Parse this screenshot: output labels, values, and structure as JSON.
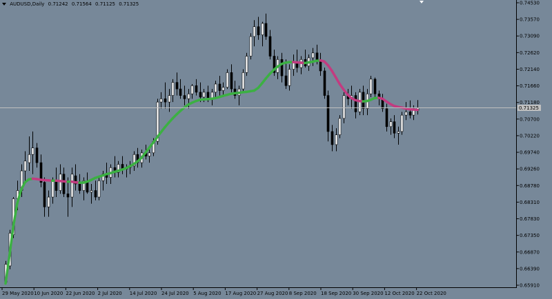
{
  "header": {
    "symbol": "AUDUSD,Daily",
    "open": "0.71242",
    "high": "0.71564",
    "low": "0.71125",
    "close": "0.71325"
  },
  "colors": {
    "background": "#778899",
    "bull_body": "#ffffff",
    "bear_body": "#000000",
    "wick": "#000000",
    "ma_up": "#3cb043",
    "ma_down": "#c23b80",
    "bid_line": "#c0c0c0",
    "current_label_bg": "#c0c0c0"
  },
  "price_axis": {
    "labels": [
      "0.74530",
      "0.73570",
      "0.73090",
      "0.72620",
      "0.72140",
      "0.71660",
      "0.71180",
      "0.70700",
      "0.70220",
      "0.69740",
      "0.69260",
      "0.68780",
      "0.68310",
      "0.67830",
      "0.67350",
      "0.66870",
      "0.66390",
      "0.65910"
    ],
    "current_price_label": "0.71325"
  },
  "time_axis": {
    "labels": [
      "29 May 2020",
      "10 Jun 2020",
      "22 Jun 2020",
      "2 Jul 2020",
      "14 Jul 2020",
      "24 Jul 2020",
      "5 Aug 2020",
      "17 Aug 2020",
      "27 Aug 2020",
      "8 Sep 2020",
      "18 Sep 2020",
      "30 Sep 2020",
      "12 Oct 2020",
      "22 Oct 2020"
    ]
  },
  "chart_data": {
    "type": "candlestick",
    "symbol": "AUDUSD",
    "timeframe": "Daily",
    "ylim": [
      0.6591,
      0.7453
    ],
    "current_price": 0.71325,
    "candles": [
      [
        0.66,
        0.6665,
        0.6595,
        0.6655
      ],
      [
        0.665,
        0.676,
        0.664,
        0.675
      ],
      [
        0.6745,
        0.686,
        0.6735,
        0.6855
      ],
      [
        0.6855,
        0.691,
        0.682,
        0.688
      ],
      [
        0.688,
        0.696,
        0.686,
        0.694
      ],
      [
        0.694,
        0.7,
        0.69,
        0.697
      ],
      [
        0.6965,
        0.7045,
        0.694,
        0.699
      ],
      [
        0.699,
        0.706,
        0.693,
        0.701
      ],
      [
        0.701,
        0.7025,
        0.695,
        0.6965
      ],
      [
        0.6965,
        0.699,
        0.689,
        0.6905
      ],
      [
        0.6905,
        0.692,
        0.68,
        0.683
      ],
      [
        0.683,
        0.688,
        0.68,
        0.686
      ],
      [
        0.686,
        0.692,
        0.684,
        0.691
      ],
      [
        0.691,
        0.695,
        0.686,
        0.688
      ],
      [
        0.688,
        0.696,
        0.687,
        0.693
      ],
      [
        0.693,
        0.695,
        0.686,
        0.687
      ],
      [
        0.687,
        0.692,
        0.68,
        0.686
      ],
      [
        0.686,
        0.695,
        0.683,
        0.693
      ],
      [
        0.6925,
        0.696,
        0.688,
        0.69
      ],
      [
        0.69,
        0.693,
        0.687,
        0.688
      ],
      [
        0.688,
        0.692,
        0.685,
        0.691
      ],
      [
        0.6905,
        0.6935,
        0.687,
        0.6875
      ],
      [
        0.6875,
        0.69,
        0.684,
        0.688
      ],
      [
        0.688,
        0.691,
        0.685,
        0.686
      ],
      [
        0.686,
        0.6925,
        0.685,
        0.691
      ],
      [
        0.691,
        0.694,
        0.688,
        0.693
      ],
      [
        0.693,
        0.6965,
        0.69,
        0.692
      ],
      [
        0.692,
        0.696,
        0.69,
        0.695
      ],
      [
        0.695,
        0.6985,
        0.692,
        0.6935
      ],
      [
        0.6935,
        0.697,
        0.692,
        0.696
      ],
      [
        0.696,
        0.6985,
        0.693,
        0.6945
      ],
      [
        0.6945,
        0.696,
        0.692,
        0.695
      ],
      [
        0.695,
        0.697,
        0.693,
        0.6955
      ],
      [
        0.6955,
        0.7,
        0.694,
        0.699
      ],
      [
        0.699,
        0.701,
        0.695,
        0.6965
      ],
      [
        0.6965,
        0.7005,
        0.695,
        0.6995
      ],
      [
        0.6995,
        0.702,
        0.6975,
        0.6985
      ],
      [
        0.6985,
        0.7005,
        0.6965,
        0.6995
      ],
      [
        0.6995,
        0.704,
        0.6985,
        0.703
      ],
      [
        0.703,
        0.716,
        0.702,
        0.715
      ],
      [
        0.715,
        0.718,
        0.713,
        0.716
      ],
      [
        0.716,
        0.721,
        0.713,
        0.715
      ],
      [
        0.715,
        0.719,
        0.712,
        0.717
      ],
      [
        0.717,
        0.722,
        0.715,
        0.721
      ],
      [
        0.721,
        0.724,
        0.717,
        0.719
      ],
      [
        0.719,
        0.722,
        0.716,
        0.717
      ],
      [
        0.717,
        0.72,
        0.714,
        0.716
      ],
      [
        0.716,
        0.719,
        0.713,
        0.7175
      ],
      [
        0.7175,
        0.7205,
        0.716,
        0.72
      ],
      [
        0.72,
        0.722,
        0.717,
        0.718
      ],
      [
        0.718,
        0.721,
        0.715,
        0.7165
      ],
      [
        0.7165,
        0.719,
        0.715,
        0.718
      ],
      [
        0.718,
        0.72,
        0.715,
        0.716
      ],
      [
        0.716,
        0.719,
        0.714,
        0.718
      ],
      [
        0.718,
        0.7215,
        0.716,
        0.7205
      ],
      [
        0.7205,
        0.723,
        0.717,
        0.7185
      ],
      [
        0.7185,
        0.721,
        0.7165,
        0.7195
      ],
      [
        0.7195,
        0.725,
        0.719,
        0.724
      ],
      [
        0.724,
        0.7265,
        0.718,
        0.719
      ],
      [
        0.719,
        0.7215,
        0.716,
        0.717
      ],
      [
        0.717,
        0.72,
        0.714,
        0.719
      ],
      [
        0.719,
        0.725,
        0.718,
        0.724
      ],
      [
        0.724,
        0.73,
        0.723,
        0.729
      ],
      [
        0.729,
        0.736,
        0.728,
        0.735
      ],
      [
        0.735,
        0.74,
        0.732,
        0.738
      ],
      [
        0.738,
        0.741,
        0.734,
        0.7355
      ],
      [
        0.7355,
        0.7395,
        0.732,
        0.739
      ],
      [
        0.739,
        0.742,
        0.734,
        0.735
      ],
      [
        0.735,
        0.737,
        0.728,
        0.729
      ],
      [
        0.729,
        0.731,
        0.723,
        0.724
      ],
      [
        0.724,
        0.729,
        0.722,
        0.728
      ],
      [
        0.728,
        0.73,
        0.721,
        0.723
      ],
      [
        0.723,
        0.728,
        0.719,
        0.72
      ],
      [
        0.72,
        0.7265,
        0.7185,
        0.725
      ],
      [
        0.725,
        0.7295,
        0.723,
        0.727
      ],
      [
        0.727,
        0.731,
        0.724,
        0.7255
      ],
      [
        0.7255,
        0.729,
        0.7235,
        0.728
      ],
      [
        0.728,
        0.731,
        0.7255,
        0.726
      ],
      [
        0.726,
        0.7295,
        0.7245,
        0.7285
      ],
      [
        0.7285,
        0.7315,
        0.726,
        0.73
      ],
      [
        0.73,
        0.7325,
        0.7265,
        0.7275
      ],
      [
        0.7275,
        0.73,
        0.723,
        0.7245
      ],
      [
        0.7245,
        0.7255,
        0.716,
        0.717
      ],
      [
        0.717,
        0.7185,
        0.703,
        0.706
      ],
      [
        0.706,
        0.708,
        0.7,
        0.702
      ],
      [
        0.702,
        0.707,
        0.7,
        0.705
      ],
      [
        0.705,
        0.711,
        0.704,
        0.71
      ],
      [
        0.71,
        0.718,
        0.7085,
        0.717
      ],
      [
        0.717,
        0.719,
        0.714,
        0.716
      ],
      [
        0.716,
        0.72,
        0.713,
        0.717
      ],
      [
        0.717,
        0.718,
        0.71,
        0.712
      ],
      [
        0.712,
        0.719,
        0.711,
        0.718
      ],
      [
        0.718,
        0.72,
        0.711,
        0.713
      ],
      [
        0.713,
        0.719,
        0.711,
        0.7175
      ],
      [
        0.7175,
        0.723,
        0.7165,
        0.722
      ],
      [
        0.722,
        0.7225,
        0.716,
        0.7175
      ],
      [
        0.7175,
        0.7185,
        0.714,
        0.716
      ],
      [
        0.716,
        0.7175,
        0.712,
        0.713
      ],
      [
        0.713,
        0.7145,
        0.706,
        0.7075
      ],
      [
        0.7075,
        0.71,
        0.705,
        0.709
      ],
      [
        0.709,
        0.711,
        0.704,
        0.7055
      ],
      [
        0.7055,
        0.7075,
        0.702,
        0.706
      ],
      [
        0.706,
        0.712,
        0.705,
        0.711
      ],
      [
        0.711,
        0.715,
        0.7095,
        0.712
      ],
      [
        0.712,
        0.7155,
        0.71,
        0.711
      ],
      [
        0.711,
        0.714,
        0.7095,
        0.713
      ],
      [
        0.7125,
        0.7156,
        0.7112,
        0.7133
      ]
    ],
    "moving_average": [
      0.6596,
      0.668,
      0.677,
      0.684,
      0.6882,
      0.6905,
      0.6914,
      0.6916,
      0.6915,
      0.6913,
      0.6912,
      0.6911,
      0.691,
      0.691,
      0.6909,
      0.6908,
      0.6907,
      0.6907,
      0.6905,
      0.6904,
      0.6904,
      0.6907,
      0.6912,
      0.6918,
      0.6922,
      0.6926,
      0.693,
      0.6933,
      0.6937,
      0.694,
      0.6944,
      0.6948,
      0.6954,
      0.6961,
      0.6969,
      0.698,
      0.6995,
      0.7011,
      0.7026,
      0.7042,
      0.7058,
      0.7073,
      0.7087,
      0.71,
      0.7112,
      0.7123,
      0.7133,
      0.7142,
      0.7148,
      0.7153,
      0.7157,
      0.7158,
      0.7159,
      0.716,
      0.7162,
      0.7165,
      0.7169,
      0.7172,
      0.7175,
      0.7177,
      0.7178,
      0.718,
      0.7181,
      0.7183,
      0.7185,
      0.7193,
      0.7207,
      0.7222,
      0.7236,
      0.7248,
      0.7258,
      0.7266,
      0.727,
      0.7272,
      0.7272,
      0.7271,
      0.727,
      0.7269,
      0.7271,
      0.7273,
      0.7276,
      0.7277,
      0.7274,
      0.7262,
      0.7245,
      0.7225,
      0.7205,
      0.7188,
      0.7173,
      0.7162,
      0.7156,
      0.7153,
      0.7152,
      0.7153,
      0.7157,
      0.7162,
      0.7163,
      0.716,
      0.7152,
      0.7144,
      0.7138,
      0.7135,
      0.7133,
      0.713,
      0.7128,
      0.7127,
      0.7126
    ]
  }
}
